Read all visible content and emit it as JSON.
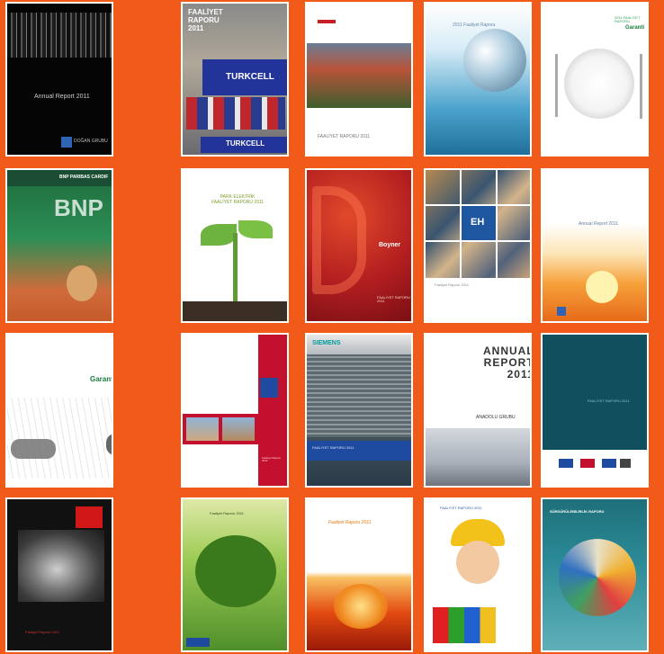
{
  "covers": [
    {
      "id": "orchestra",
      "text": "Annual Report 2011",
      "logo": "DOĞAN GRUBU"
    },
    {
      "id": "turkcell",
      "text": "FAALİYET\nRAPORU\n2011",
      "logo": "TURKCELL",
      "logo2": "TURKCELL"
    },
    {
      "id": "houses",
      "text": "FAALİYET RAPORU 2011"
    },
    {
      "id": "globe",
      "text": "2011 Faaliyet Raporu"
    },
    {
      "id": "plate",
      "text": "2011 FAALİYET RAPORU",
      "logo": "Garanti"
    },
    {
      "id": "bnp",
      "text": "BNP PARIBAS CARDIF",
      "logo": "BNP"
    },
    {
      "id": "sprout",
      "text": "PARK ELEKTRİK\nFAALİYET RAPORU 2011"
    },
    {
      "id": "boyner",
      "text": "FAALİYET RAPORU\n2011",
      "logo": "Boyner"
    },
    {
      "id": "collage",
      "text": "Faaliyet Raporu 2011",
      "logo": "EH"
    },
    {
      "id": "sunset",
      "text": "Annual Report 2011"
    },
    {
      "id": "hands",
      "text": "Garanti",
      "logo": "Garanti"
    },
    {
      "id": "redbuild",
      "text": "Faaliyet Raporu 2011"
    },
    {
      "id": "siemens",
      "text": "FAALİYET RAPORU 2011",
      "logo": "SIEMENS"
    },
    {
      "id": "anadolu",
      "text": "ANNUAL\nREPORT\n2011",
      "logo": "ANADOLU GRUBU"
    },
    {
      "id": "teal",
      "text": "FAALİYET RAPORU 2011"
    },
    {
      "id": "rock",
      "text": "Faaliyet Raporu 2011"
    },
    {
      "id": "tree",
      "text": "Faaliyet Raporu 2011"
    },
    {
      "id": "fire",
      "text": "Faaliyet Raporu 2011"
    },
    {
      "id": "child",
      "text": "FAALİYET RAPORU 2011"
    },
    {
      "id": "shell",
      "text": "SÜRDÜRÜLEBİLİRLİK RAPORU"
    }
  ]
}
